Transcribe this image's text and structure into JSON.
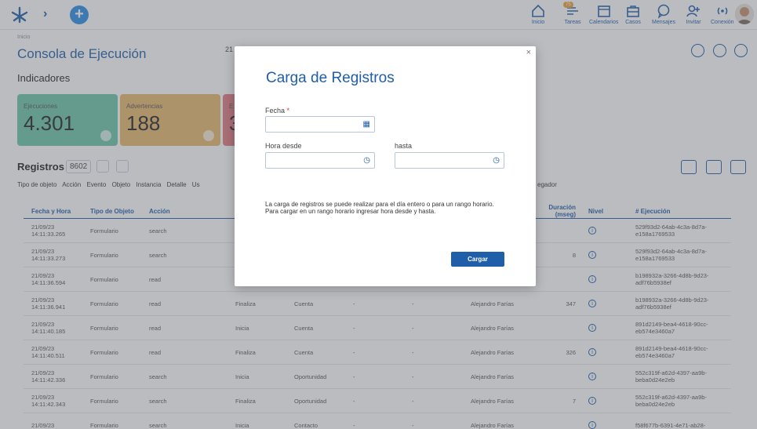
{
  "nav": {
    "items": [
      {
        "label": "Inicio",
        "icon": "home-icon"
      },
      {
        "label": "Tareas",
        "icon": "tasks-icon",
        "badge": "75"
      },
      {
        "label": "Calendarios",
        "icon": "calendar-icon"
      },
      {
        "label": "Casos",
        "icon": "cases-icon"
      },
      {
        "label": "Mensajes",
        "icon": "message-icon"
      },
      {
        "label": "Invitar",
        "icon": "invite-icon"
      },
      {
        "label": "Conexión",
        "icon": "connection-icon"
      }
    ],
    "accent": "#1f5ea8"
  },
  "page": {
    "breadcrumb": "Inicio",
    "title": "Consola de Ejecución",
    "date_partial": "21",
    "indicadores_title": "Indicadores",
    "cards": [
      {
        "label": "Ejecuciones",
        "value": "4.301",
        "color": "#6cc7a8"
      },
      {
        "label": "Advertencias",
        "value": "188",
        "color": "#e8b86a"
      },
      {
        "label": "E",
        "value": "3",
        "color": "#e47a82"
      }
    ]
  },
  "registros": {
    "title": "Registros",
    "count": "8602",
    "filters": [
      "Tipo de objeto",
      "Acción",
      "Evento",
      "Objeto",
      "Instancia",
      "Detalle",
      "Us"
    ],
    "filter_right": "egador",
    "columns": [
      "Fecha y Hora",
      "Tipo de Objeto",
      "Acción",
      "",
      "",
      "",
      "",
      "",
      "Duración (mseg)",
      "Nivel",
      "# Ejecución"
    ],
    "rows": [
      [
        "21/09/23 14:11:33.265",
        "Formulario",
        "search",
        "",
        "",
        "",
        "",
        "",
        "",
        "i",
        "529f93d2-64ab-4c3a-8d7a-e158a1769533"
      ],
      [
        "21/09/23 14:11:33.273",
        "Formulario",
        "search",
        "",
        "",
        "",
        "",
        "",
        "8",
        "i",
        "529f93d2-64ab-4c3a-8d7a-e158a1769533"
      ],
      [
        "21/09/23 14:11:36.594",
        "Formulario",
        "read",
        "",
        "",
        "",
        "",
        "",
        "",
        "i",
        "b198932a-3266-4d8b-9d23-adf76b5938ef"
      ],
      [
        "21/09/23 14:11:36.941",
        "Formulario",
        "read",
        "Finaliza",
        "Cuenta",
        "-",
        "-",
        "Alejandro Farías",
        "347",
        "i",
        "b198932a-3266-4d8b-9d23-adf76b5938ef"
      ],
      [
        "21/09/23 14:11:40.185",
        "Formulario",
        "read",
        "Inicia",
        "Cuenta",
        "-",
        "-",
        "Alejandro Farías",
        "",
        "i",
        "891d2149-bea4-4618-90cc-eb574e3460a7"
      ],
      [
        "21/09/23 14:11:40.511",
        "Formulario",
        "read",
        "Finaliza",
        "Cuenta",
        "-",
        "-",
        "Alejandro Farías",
        "326",
        "i",
        "891d2149-bea4-4618-90cc-eb574e3460a7"
      ],
      [
        "21/09/23 14:11:42.336",
        "Formulario",
        "search",
        "Inicia",
        "Oportunidad",
        "-",
        "-",
        "Alejandro Farías",
        "",
        "i",
        "552c319f-a62d-4397-aa9b-beba0d24e2eb"
      ],
      [
        "21/09/23 14:11:42.343",
        "Formulario",
        "search",
        "Finaliza",
        "Oportunidad",
        "-",
        "-",
        "Alejandro Farías",
        "7",
        "i",
        "552c319f-a62d-4397-aa9b-beba0d24e2eb"
      ],
      [
        "21/09/23",
        "Formulario",
        "search",
        "Inicia",
        "Contacto",
        "-",
        "-",
        "Alejandro Farías",
        "",
        "i",
        "f58f677b-6391-4e71-ab28-"
      ]
    ]
  },
  "modal": {
    "title": "Carga de Registros",
    "fecha_label": "Fecha",
    "required_mark": "*",
    "hora_desde_label": "Hora desde",
    "hasta_label": "hasta",
    "fecha_value": "",
    "hora_desde_value": "",
    "hasta_value": "",
    "note_line1": "La carga de registros se puede realizar para el día entero o para un rango horario.",
    "note_line2": "Para cargar en un rango horario ingresar hora desde y hasta.",
    "submit_label": "Cargar",
    "close_glyph": "×"
  }
}
